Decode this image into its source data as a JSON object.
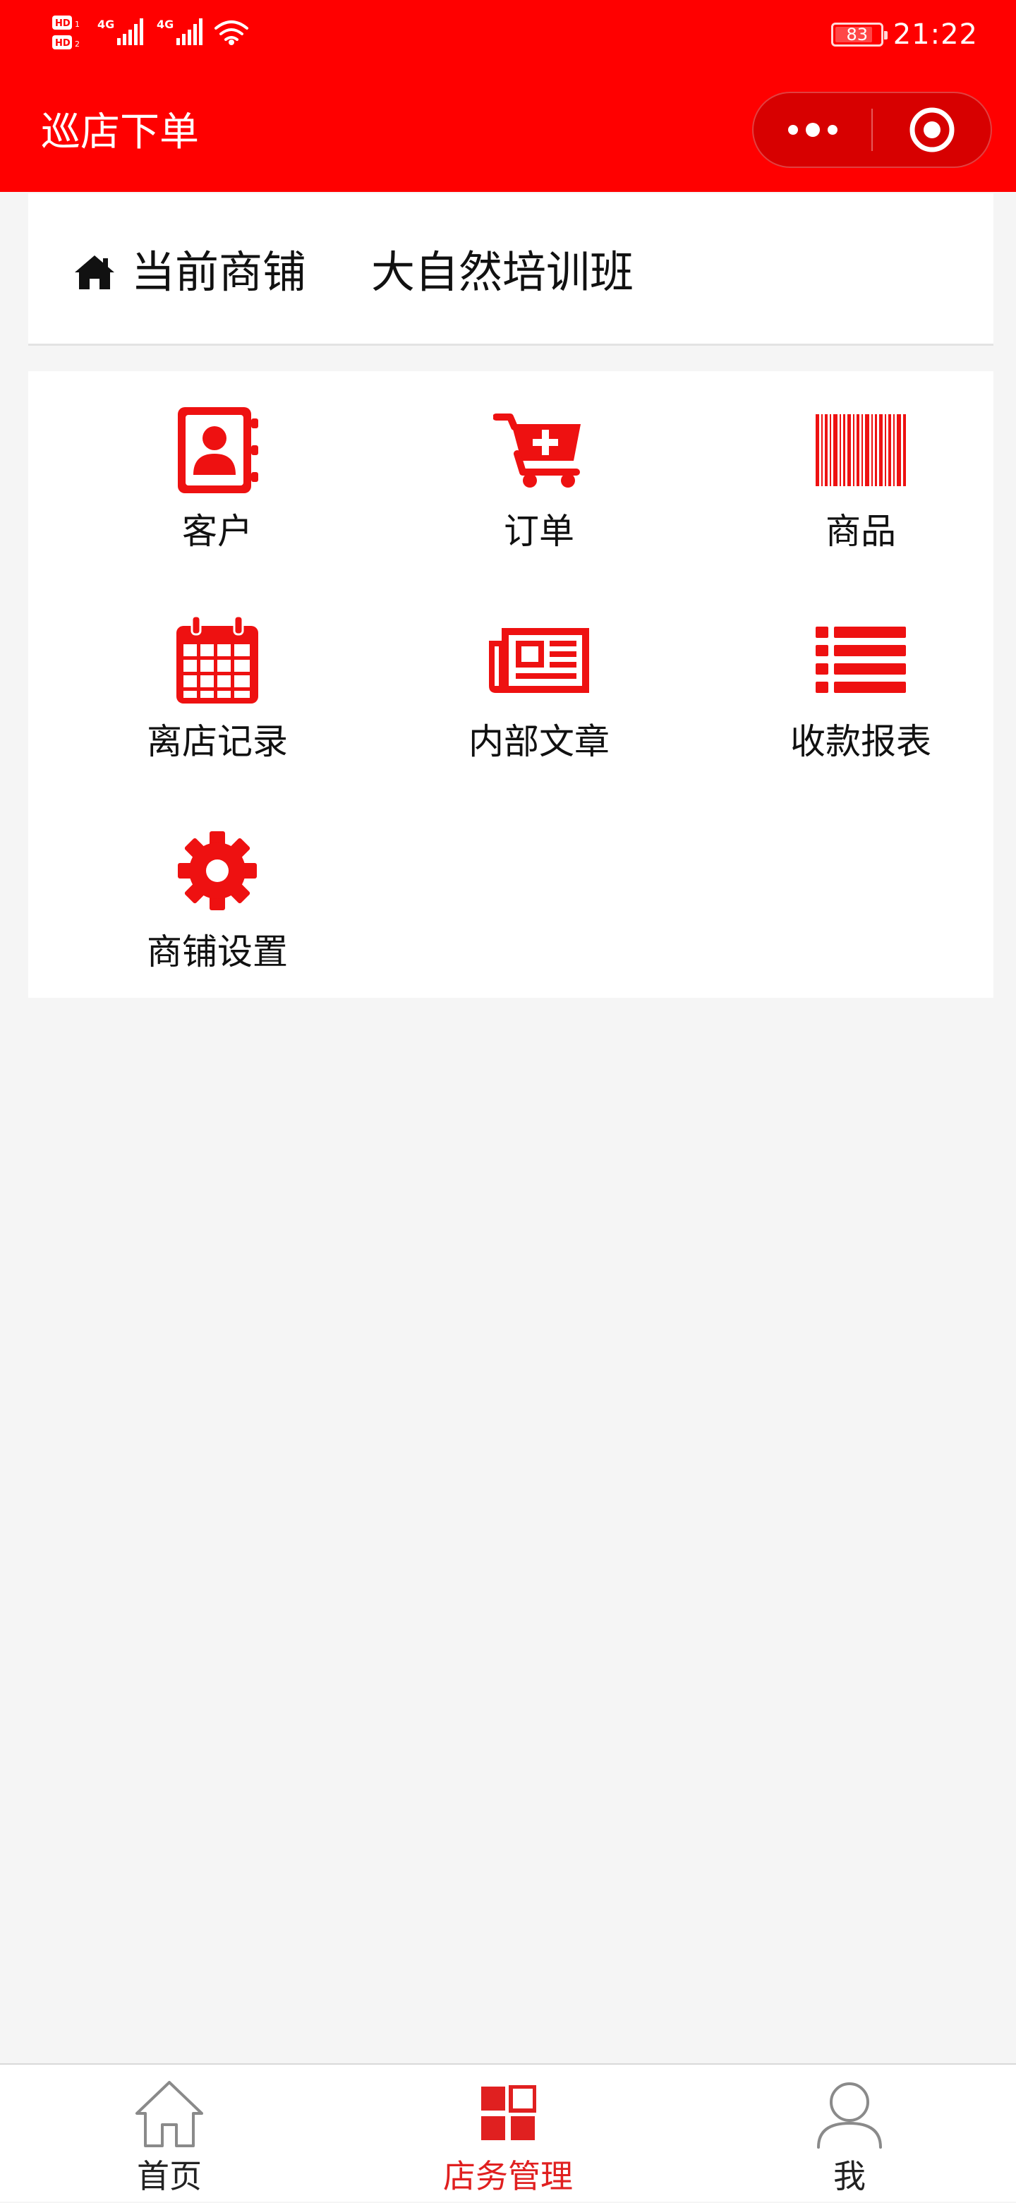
{
  "status_bar": {
    "time": "21:22",
    "battery_level": "83",
    "network_1": "4G",
    "network_2": "4G",
    "hd_1": "HD",
    "hd_2": "HD"
  },
  "nav": {
    "title": "巡店下单",
    "menu_icon": "more-dots-icon",
    "close_icon": "target-circle-icon"
  },
  "shop": {
    "label": "当前商铺",
    "name": "大自然培训班",
    "icon": "home-icon"
  },
  "menu": {
    "items": [
      {
        "label": "客户",
        "icon": "contacts-book-icon"
      },
      {
        "label": "订单",
        "icon": "cart-plus-icon"
      },
      {
        "label": "商品",
        "icon": "barcode-icon"
      },
      {
        "label": "离店记录",
        "icon": "calendar-icon"
      },
      {
        "label": "内部文章",
        "icon": "newspaper-icon"
      },
      {
        "label": "收款报表",
        "icon": "list-icon"
      },
      {
        "label": "商铺设置",
        "icon": "gear-icon"
      }
    ]
  },
  "tabbar": {
    "tabs": [
      {
        "label": "首页",
        "icon": "home-outline-icon",
        "active": false
      },
      {
        "label": "店务管理",
        "icon": "grid-squares-icon",
        "active": true
      },
      {
        "label": "我",
        "icon": "user-outline-icon",
        "active": false
      }
    ]
  },
  "colors": {
    "brand_red": "#ff0000",
    "icon_red": "#ee1111",
    "active_tab": "#e02020",
    "page_bg": "#f5f5f5"
  }
}
